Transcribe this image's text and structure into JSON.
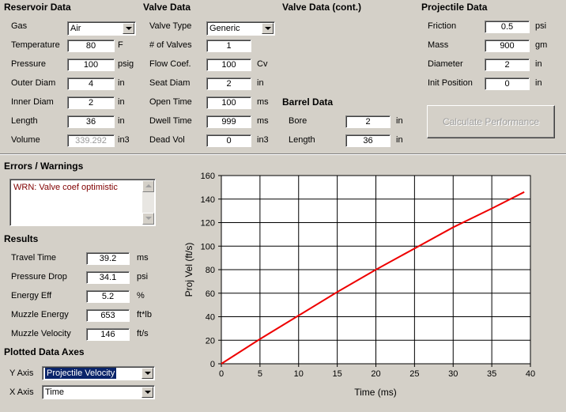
{
  "reservoir": {
    "title": "Reservoir Data",
    "gas_label": "Gas",
    "gas_value": "Air",
    "temperature_label": "Temperature",
    "temperature_value": "80",
    "temperature_unit": "F",
    "pressure_label": "Pressure",
    "pressure_value": "100",
    "pressure_unit": "psig",
    "outer_diam_label": "Outer Diam",
    "outer_diam_value": "4",
    "outer_diam_unit": "in",
    "inner_diam_label": "Inner Diam",
    "inner_diam_value": "2",
    "inner_diam_unit": "in",
    "length_label": "Length",
    "length_value": "36",
    "length_unit": "in",
    "volume_label": "Volume",
    "volume_value": "339.292",
    "volume_unit": "in3"
  },
  "valve": {
    "title": "Valve Data",
    "type_label": "Valve Type",
    "type_value": "Generic",
    "num_valves_label": "# of Valves",
    "num_valves_value": "1",
    "flow_coef_label": "Flow Coef.",
    "flow_coef_value": "100",
    "flow_coef_unit": "Cv",
    "seat_diam_label": "Seat Diam",
    "seat_diam_value": "2",
    "seat_diam_unit": "in",
    "open_time_label": "Open Time",
    "open_time_value": "100",
    "open_time_unit": "ms",
    "dwell_time_label": "Dwell Time",
    "dwell_time_value": "999",
    "dwell_time_unit": "ms",
    "dead_vol_label": "Dead Vol",
    "dead_vol_value": "0",
    "dead_vol_unit": "in3"
  },
  "valve_cont": {
    "title": "Valve Data (cont.)"
  },
  "barrel": {
    "title": "Barrel Data",
    "bore_label": "Bore",
    "bore_value": "2",
    "bore_unit": "in",
    "length_label": "Length",
    "length_value": "36",
    "length_unit": "in"
  },
  "projectile": {
    "title": "Projectile Data",
    "friction_label": "Friction",
    "friction_value": "0.5",
    "friction_unit": "psi",
    "mass_label": "Mass",
    "mass_value": "900",
    "mass_unit": "gm",
    "diameter_label": "Diameter",
    "diameter_value": "2",
    "diameter_unit": "in",
    "init_pos_label": "Init Position",
    "init_pos_value": "0",
    "init_pos_unit": "in"
  },
  "calculate_button": "Calculate Performance",
  "errors": {
    "title": "Errors / Warnings",
    "message": "WRN: Valve coef optimistic"
  },
  "results": {
    "title": "Results",
    "travel_time_label": "Travel Time",
    "travel_time_value": "39.2",
    "travel_time_unit": "ms",
    "pressure_drop_label": "Pressure Drop",
    "pressure_drop_value": "34.1",
    "pressure_drop_unit": "psi",
    "energy_eff_label": "Energy Eff",
    "energy_eff_value": "5.2",
    "energy_eff_unit": "%",
    "muzzle_energy_label": "Muzzle Energy",
    "muzzle_energy_value": "653",
    "muzzle_energy_unit": "ft*lb",
    "muzzle_velocity_label": "Muzzle Velocity",
    "muzzle_velocity_value": "146",
    "muzzle_velocity_unit": "ft/s"
  },
  "axes": {
    "title": "Plotted Data Axes",
    "y_label": "Y Axis",
    "y_value": "Projectile Velocity",
    "x_label": "X Axis",
    "x_value": "Time"
  },
  "chart_data": {
    "type": "line",
    "title": "",
    "xlabel": "Time (ms)",
    "ylabel": "Proj Vel (ft/s)",
    "xlim": [
      0,
      40
    ],
    "ylim": [
      0,
      160
    ],
    "xticks": [
      "0",
      "5",
      "10",
      "15",
      "20",
      "25",
      "30",
      "35",
      "40"
    ],
    "yticks": [
      "0",
      "20",
      "40",
      "60",
      "80",
      "100",
      "120",
      "140",
      "160"
    ],
    "grid": true,
    "series_color": "#ee0000",
    "series": [
      {
        "x": [
          0,
          2.5,
          5,
          10,
          15,
          20,
          25,
          30,
          35,
          39.2
        ],
        "y": [
          0,
          10.5,
          21,
          41,
          61,
          80,
          98,
          116,
          132,
          146
        ]
      }
    ]
  }
}
